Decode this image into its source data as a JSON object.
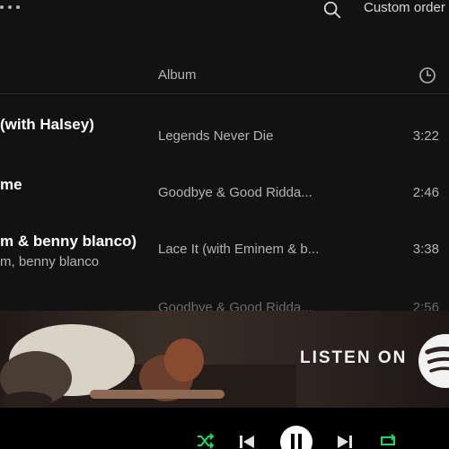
{
  "topbar": {
    "menu_icon": "more-dots-icon",
    "search_icon": "search-icon",
    "sort_label": "Custom order"
  },
  "header": {
    "album_label": "Album",
    "duration_icon": "clock-icon"
  },
  "tracks": [
    {
      "title": "(with Halsey)",
      "artist": "",
      "album": "Legends Never Die",
      "duration": "3:22"
    },
    {
      "title": "me",
      "artist": "",
      "album": "Goodbye & Good Ridda...",
      "duration": "2:46"
    },
    {
      "title": "m & benny blanco)",
      "artist": "m, benny blanco",
      "album": "Lace It (with Eminem & b...",
      "duration": "3:38"
    }
  ],
  "partial_track": {
    "album": "Goodbye & Good Ridda...",
    "duration": "2:56"
  },
  "ad": {
    "text": "LISTEN ON",
    "logo": "spotify-logo-icon",
    "colors": {
      "background": "#2e2420",
      "text": "#f2f2f2"
    }
  },
  "player": {
    "controls": [
      "shuffle-icon",
      "previous-icon",
      "pause-icon",
      "next-icon",
      "repeat-icon"
    ],
    "shuffle_active": true,
    "repeat_active": true,
    "accent_color": "#1ed760"
  }
}
